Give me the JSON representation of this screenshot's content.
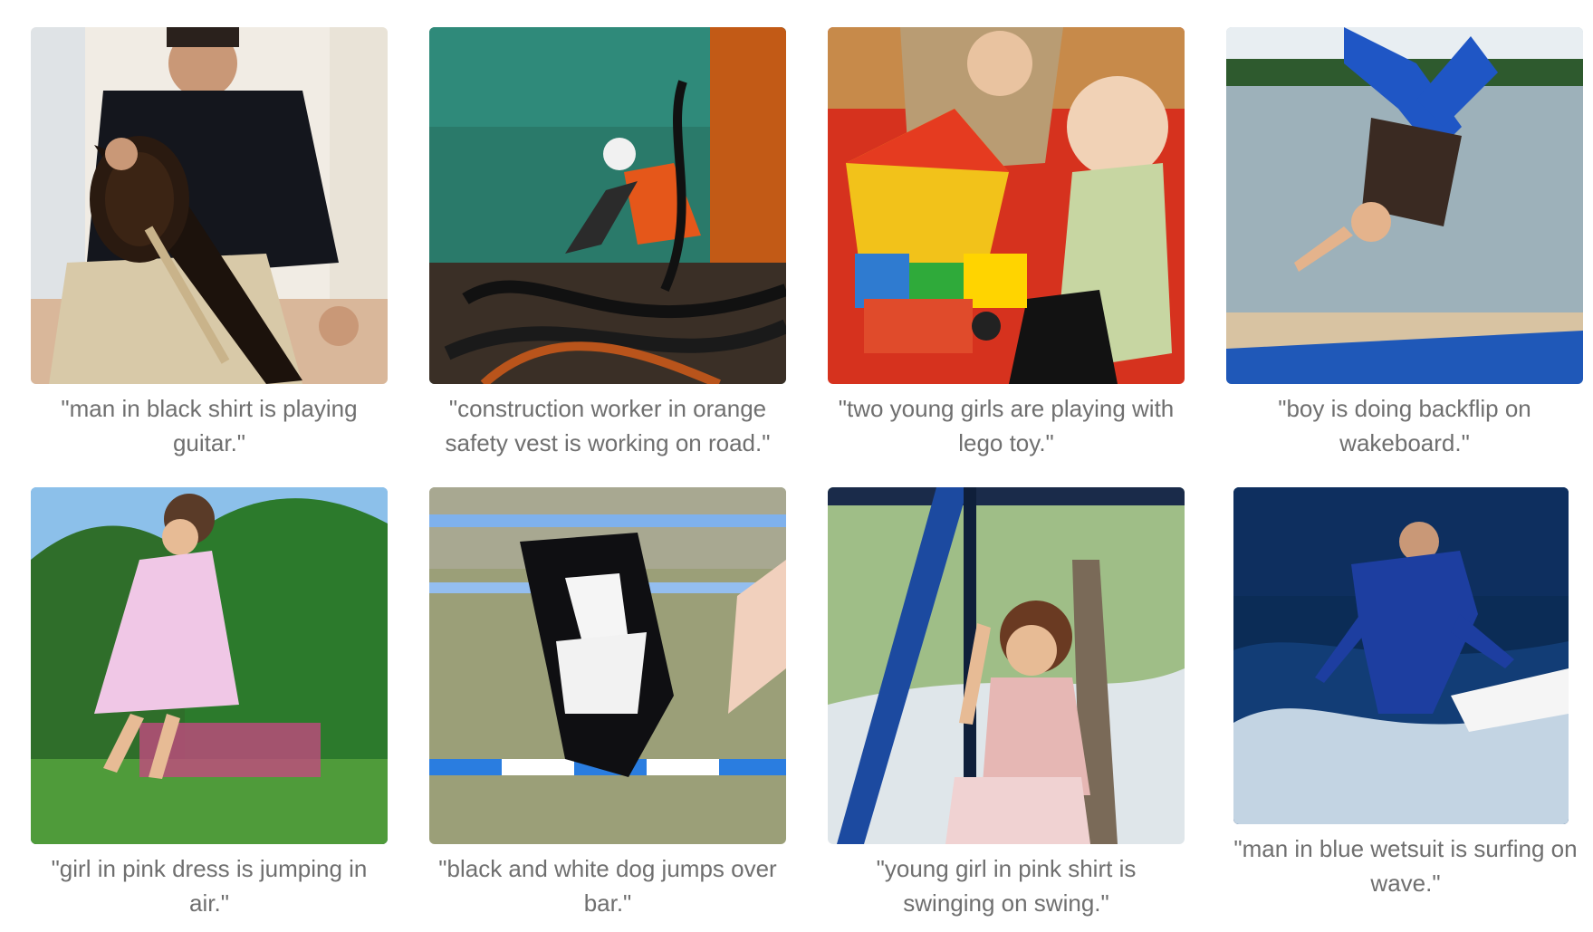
{
  "gallery": {
    "items": [
      {
        "caption": "\"man in black shirt is playing guitar.\"",
        "image_icon": "man-playing-guitar-photo"
      },
      {
        "caption": "\"construction worker in orange safety vest is working on road.\"",
        "image_icon": "construction-worker-photo"
      },
      {
        "caption": "\"two young girls are playing with lego toy.\"",
        "image_icon": "child-playing-lego-photo"
      },
      {
        "caption": "\"boy is doing backflip on wakeboard.\"",
        "image_icon": "boy-backflip-photo"
      },
      {
        "caption": "\"girl in pink dress is jumping in air.\"",
        "image_icon": "girl-jumping-photo"
      },
      {
        "caption": "\"black and white dog jumps over bar.\"",
        "image_icon": "dog-jumping-bar-photo"
      },
      {
        "caption": "\"young girl in pink shirt is swinging on swing.\"",
        "image_icon": "girl-on-swing-photo"
      },
      {
        "caption": "\"man in blue wetsuit is surfing on wave.\"",
        "image_icon": "surfer-photo"
      }
    ]
  },
  "colors": {
    "caption_text": "#6f6f6f",
    "background": "#ffffff"
  }
}
